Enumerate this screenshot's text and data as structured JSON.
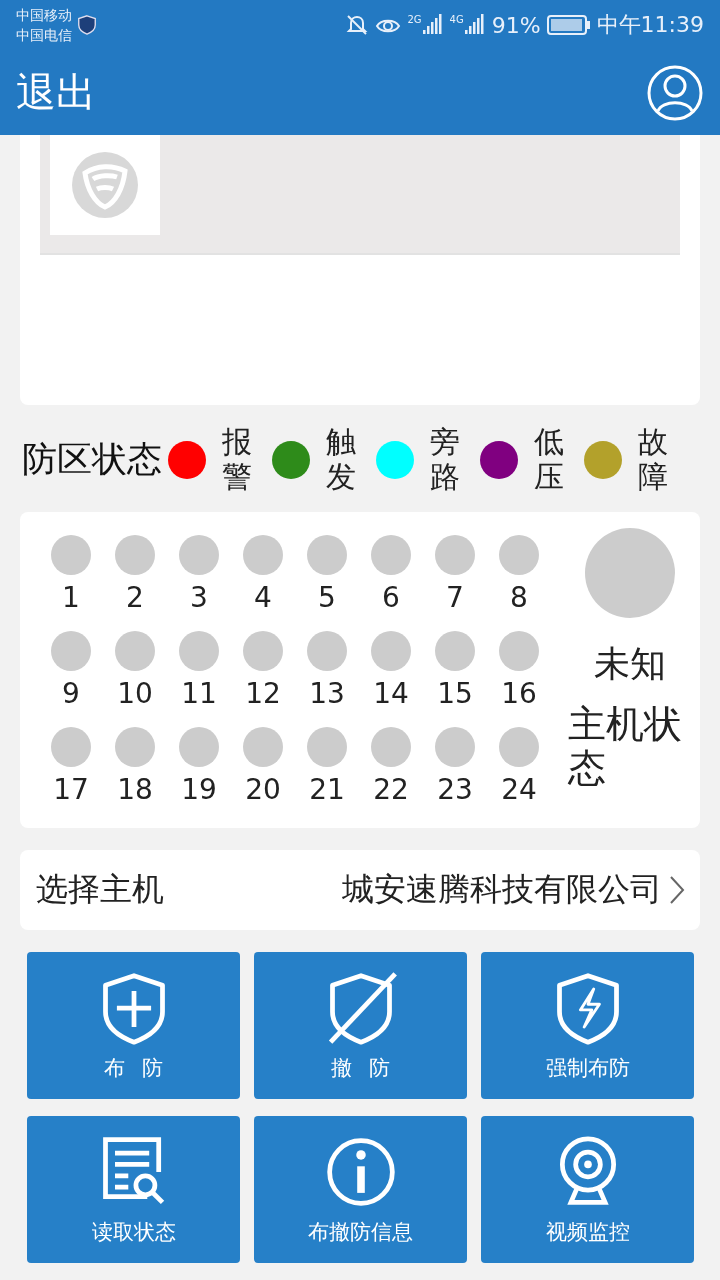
{
  "status_bar": {
    "carriers": [
      "中国移动",
      "中国电信"
    ],
    "network_labels": [
      "2G",
      "4G"
    ],
    "battery": "91%",
    "time": "中午11:39"
  },
  "header": {
    "back": "退出"
  },
  "legend": {
    "title": "防区状态",
    "items": [
      {
        "label": "报警",
        "color": "#ff0000"
      },
      {
        "label": "触发",
        "color": "#2e8b1a"
      },
      {
        "label": "旁路",
        "color": "#00ffff"
      },
      {
        "label": "低压",
        "color": "#800080"
      },
      {
        "label": "故障",
        "color": "#b3a12b"
      }
    ]
  },
  "zones": {
    "items": [
      "1",
      "2",
      "3",
      "4",
      "5",
      "6",
      "7",
      "8",
      "9",
      "10",
      "11",
      "12",
      "13",
      "14",
      "15",
      "16",
      "17",
      "18",
      "19",
      "20",
      "21",
      "22",
      "23",
      "24"
    ],
    "host_status": {
      "value": "未知",
      "label": "主机状态"
    }
  },
  "host_select": {
    "label": "选择主机",
    "value": "城安速腾科技有限公司"
  },
  "actions": [
    {
      "label": "布 防",
      "kind": "arm"
    },
    {
      "label": "撤 防",
      "kind": "disarm"
    },
    {
      "label": "强制布防",
      "kind": "force"
    },
    {
      "label": "读取状态",
      "kind": "read"
    },
    {
      "label": "布撤防信息",
      "kind": "info"
    },
    {
      "label": "视频监控",
      "kind": "video"
    }
  ]
}
